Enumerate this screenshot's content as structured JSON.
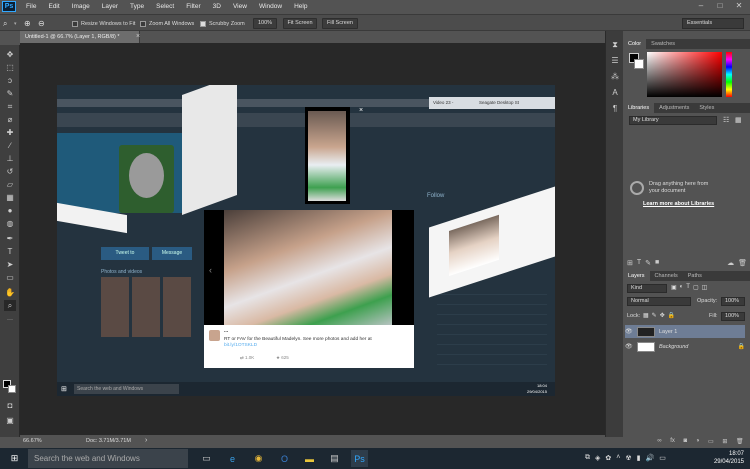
{
  "menubar": {
    "logo": "Ps",
    "items": [
      "File",
      "Edit",
      "Image",
      "Layer",
      "Type",
      "Select",
      "Filter",
      "3D",
      "View",
      "Window",
      "Help"
    ],
    "window_controls": [
      "–",
      "□",
      "✕"
    ]
  },
  "options": {
    "resize_label": "Resize Windows to Fit",
    "resize_checked": false,
    "zoom_all_label": "Zoom All Windows",
    "zoom_all_checked": false,
    "scrubby_label": "Scrubby Zoom",
    "scrubby_checked": true,
    "btn_100": "100%",
    "btn_fit": "Fit Screen",
    "btn_fill": "Fill Screen",
    "workspace": "Essentials"
  },
  "document": {
    "tab_title": "Untitled-1 @ 66.7% (Layer 1, RGB/8) *",
    "close": "×"
  },
  "canvas": {
    "tweet_user": "...",
    "tweet_text": "RT or FAV for the Beautiful Madelyn. See more photos and add her at",
    "tweet_link": "bit.ly/1OTSKLD",
    "tweet_stats": [
      "1.0K",
      "625"
    ],
    "inner_search": "Search the web and Windows",
    "follow_label": "Follow",
    "tweet_button": "Tweet to",
    "message_button": "Message",
    "photos_label": "Photos and videos",
    "browser_tab": "Seagate Desktop St",
    "browser_tab_2": "Video 23 -",
    "inner_clock_time": "18:04",
    "inner_clock_date": "29/04/2015",
    "inner_close": "×"
  },
  "status": {
    "zoom": "66.67%",
    "doc": "Doc: 3.71M/3.71M"
  },
  "panels": {
    "color_tabs": [
      "Color",
      "Swatches"
    ],
    "lib_tabs": [
      "Libraries",
      "Adjustments",
      "Styles"
    ],
    "library_select": "My Library",
    "lib_msg1": "Drag anything here from",
    "lib_msg2": "your document",
    "lib_link": "Learn more about Libraries",
    "layer_tabs": [
      "Layers",
      "Channels",
      "Paths"
    ],
    "kind_select": "Kind",
    "blend_mode": "Normal",
    "opacity_label": "Opacity:",
    "opacity_value": "100%",
    "lock_label": "Lock:",
    "fill_label": "Fill:",
    "fill_value": "100%",
    "layers": [
      {
        "name": "Layer 1"
      },
      {
        "name": "Background"
      }
    ]
  },
  "taskbar": {
    "search_placeholder": "Search the web and Windows",
    "time": "18:07",
    "date": "29/04/2015"
  },
  "colors": {
    "accent": "#31a8ff",
    "selected_layer": "#6e7d95",
    "taskbar": "#1c2731",
    "twitter_blue": "#55acee"
  }
}
